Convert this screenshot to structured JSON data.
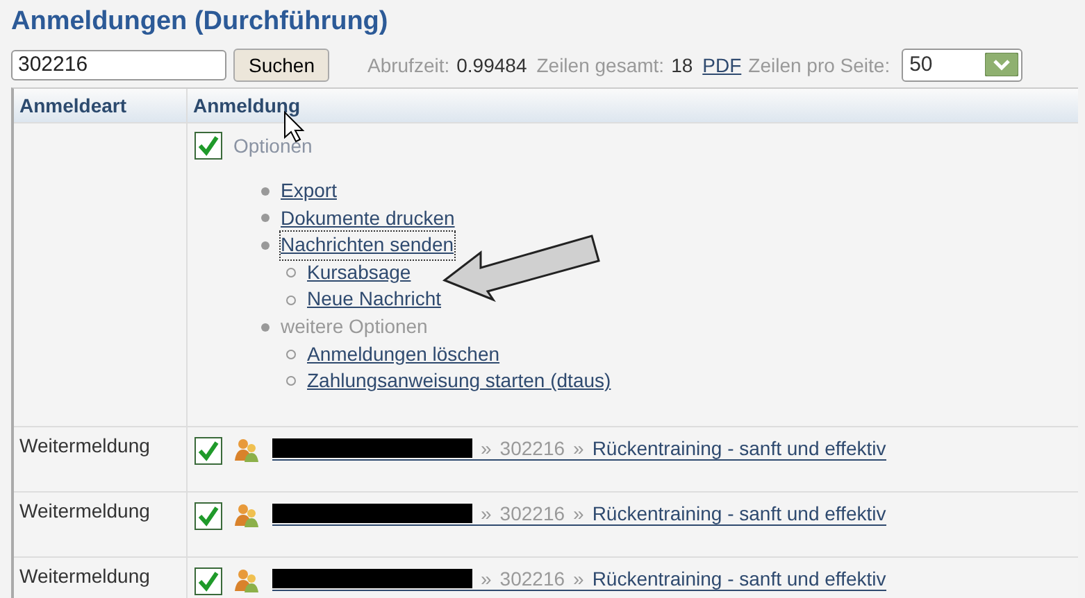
{
  "page": {
    "title": "Anmeldungen (Durchführung)"
  },
  "search": {
    "value": "302216",
    "button": "Suchen"
  },
  "stats": [
    {
      "label": "Abrufzeit:",
      "value": "0.99484"
    },
    {
      "label": "Zeilen gesamt:",
      "value": "18"
    }
  ],
  "pdf_link": "PDF",
  "rows_per_page": {
    "label": "Zeilen pro Seite:",
    "value": "50"
  },
  "table": {
    "columns": [
      "Anmeldeart",
      "Anmeldung"
    ],
    "options": {
      "checked": true,
      "label": "Optionen",
      "items": [
        {
          "label": "Export",
          "kind": "link",
          "focused": false
        },
        {
          "label": "Dokumente drucken",
          "kind": "link",
          "focused": false
        },
        {
          "label": "Nachrichten senden",
          "kind": "link",
          "focused": true,
          "children": [
            {
              "label": "Kursabsage"
            },
            {
              "label": "Neue Nachricht"
            }
          ]
        },
        {
          "label": "weitere Optionen",
          "kind": "group",
          "focused": false,
          "children": [
            {
              "label": "Anmeldungen löschen"
            },
            {
              "label": "Zahlungsanweisung starten (dtaus)"
            }
          ]
        }
      ]
    },
    "rows": [
      {
        "type": "Weitermeldung",
        "checked": true,
        "sep1": "»",
        "course_id": "302216",
        "sep2": "»",
        "course": "Rückentraining - sanft und effektiv"
      },
      {
        "type": "Weitermeldung",
        "checked": true,
        "sep1": "»",
        "course_id": "302216",
        "sep2": "»",
        "course": "Rückentraining - sanft und effektiv"
      },
      {
        "type": "Weitermeldung",
        "checked": true,
        "sep1": "»",
        "course_id": "302216",
        "sep2": "»",
        "course": "Rückentraining - sanft und effektiv"
      }
    ]
  }
}
